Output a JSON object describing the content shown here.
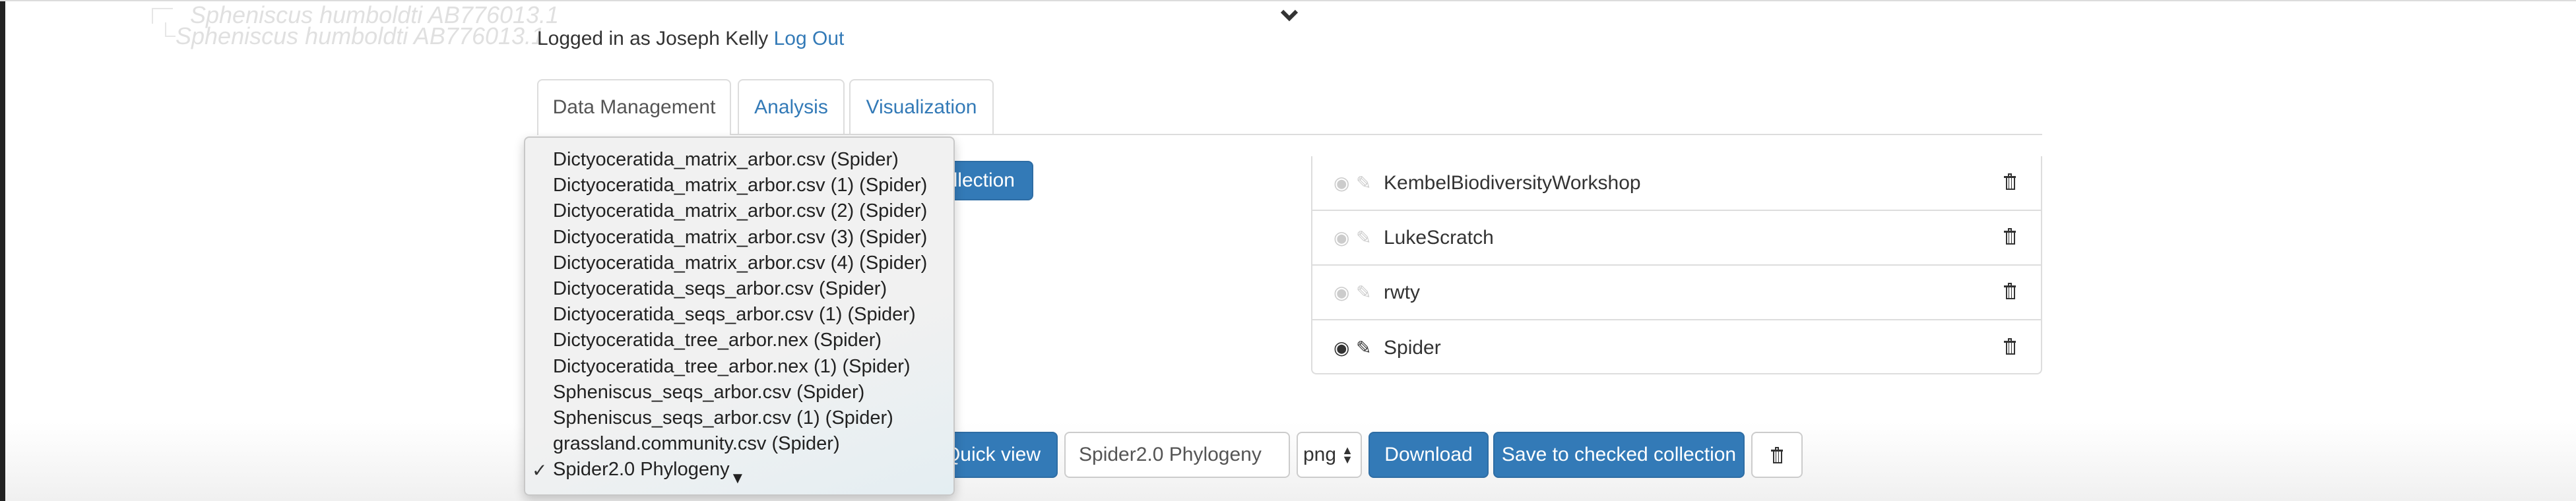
{
  "background_tree": {
    "labels": [
      "Spheniscus humboldti AB776013.1",
      "Spheniscus humboldti AB776013.1"
    ]
  },
  "header": {
    "logged_in_prefix": "Logged in as Joseph Kelly",
    "logout_label": "Log Out",
    "collapse_icon": "chevron-down-icon"
  },
  "tabs": [
    {
      "label": "Data Management",
      "active": true
    },
    {
      "label": "Analysis",
      "active": false
    },
    {
      "label": "Visualization",
      "active": false
    }
  ],
  "collection_button_label": "llection",
  "collections": [
    {
      "name": "KembelBiodiversityWorkshop",
      "active": false
    },
    {
      "name": "LukeScratch",
      "active": false
    },
    {
      "name": "rwty",
      "active": false
    },
    {
      "name": "Spider",
      "active": true
    }
  ],
  "dataset_dropdown": {
    "options": [
      "Dictyoceratida_matrix_arbor.csv (Spider)",
      "Dictyoceratida_matrix_arbor.csv (1) (Spider)",
      "Dictyoceratida_matrix_arbor.csv (2) (Spider)",
      "Dictyoceratida_matrix_arbor.csv (3) (Spider)",
      "Dictyoceratida_matrix_arbor.csv (4) (Spider)",
      "Dictyoceratida_seqs_arbor.csv (Spider)",
      "Dictyoceratida_seqs_arbor.csv (1) (Spider)",
      "Dictyoceratida_tree_arbor.nex (Spider)",
      "Dictyoceratida_tree_arbor.nex (1) (Spider)",
      "Spheniscus_seqs_arbor.csv (Spider)",
      "Spheniscus_seqs_arbor.csv (1) (Spider)",
      "grassland.community.csv (Spider)",
      "Spider2.0 Phylogeny"
    ],
    "selected": "Spider2.0 Phylogeny",
    "check_mark": "✓",
    "scroll_arrow": "▼"
  },
  "actions": {
    "quick_view_label": "Quick view",
    "name_input_value": "Spider2.0 Phylogeny",
    "format_value": "png",
    "download_label": "Download",
    "save_label": "Save to checked collection"
  },
  "colors": {
    "primary": "#337ab7",
    "link": "#337ab7"
  }
}
